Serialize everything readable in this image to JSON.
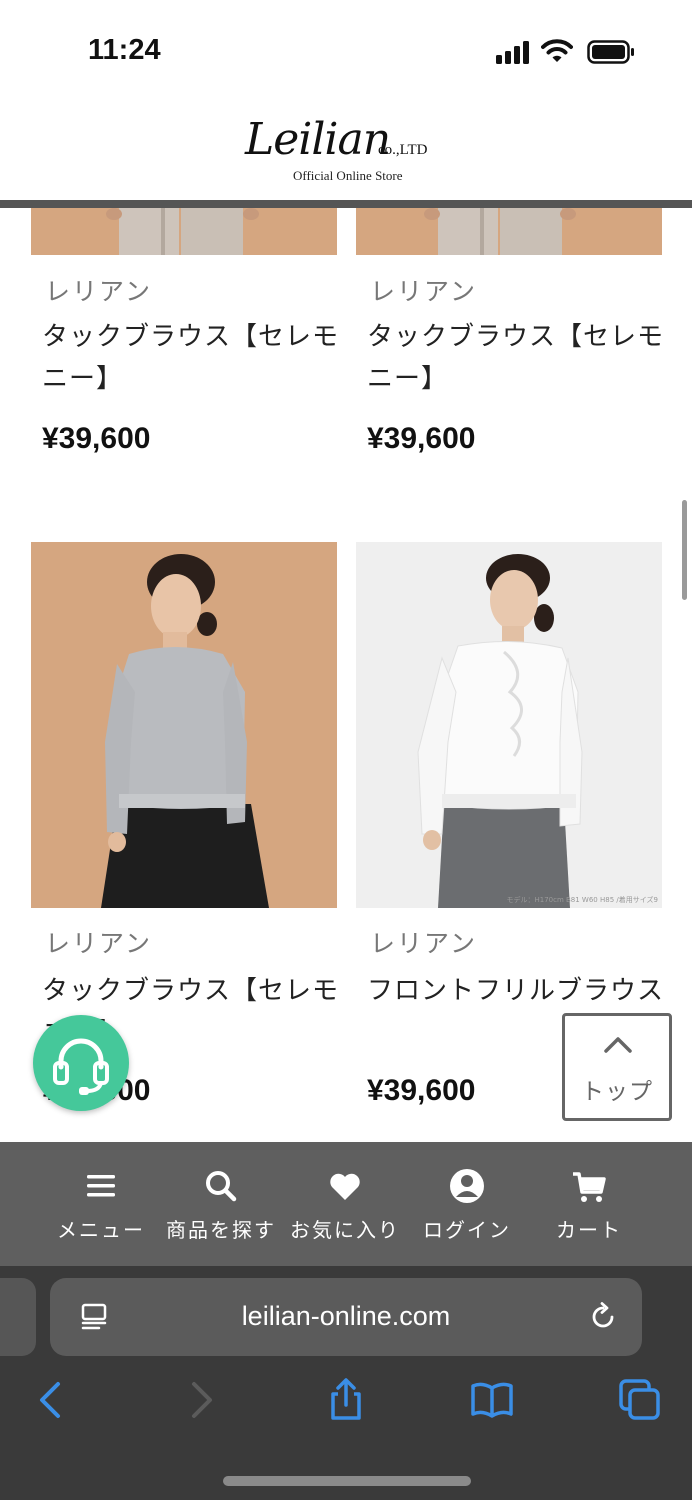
{
  "status_bar": {
    "time": "11:24"
  },
  "header": {
    "logo_script": "Leilian",
    "logo_company": "co.,LTD",
    "logo_subtitle": "Official Online Store"
  },
  "products": [
    {
      "brand": "レリアン",
      "name": "タックブラウス【セレモニー】",
      "price": "¥39,600"
    },
    {
      "brand": "レリアン",
      "name": "タックブラウス【セレモニー】",
      "price": "¥39,600"
    },
    {
      "brand": "レリアン",
      "name": "タックブラウス【セレモニー】",
      "price": "¥39,600"
    },
    {
      "brand": "レリアン",
      "name": "フロントフリルブラウス",
      "price": "¥39,600"
    }
  ],
  "image_caption": "モデル：H170cm B81 W60 H85 /着用サイズ9",
  "floating": {
    "top_label": "トップ"
  },
  "site_nav": [
    {
      "label": "メニュー",
      "icon": "menu-icon"
    },
    {
      "label": "商品を探す",
      "icon": "search-icon"
    },
    {
      "label": "お気に入り",
      "icon": "heart-icon"
    },
    {
      "label": "ログイン",
      "icon": "user-icon"
    },
    {
      "label": "カート",
      "icon": "cart-icon"
    }
  ],
  "browser": {
    "url": "leilian-online.com"
  },
  "colors": {
    "support": "#45c89a",
    "nav_bg": "#5f5f5f",
    "tan_bg": "#d5a680",
    "browser_accent": "#3a8ee6"
  }
}
